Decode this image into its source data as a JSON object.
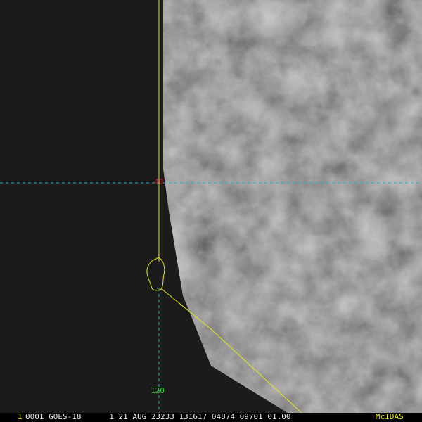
{
  "app": {
    "name": "McIDAS"
  },
  "colors": {
    "background": "#1c1c1c",
    "latlon_grid": "#1fb5c6",
    "map_overlay": "#e6e61a",
    "latitude_label": "#c0181e",
    "longitude_label": "#2ecc2e",
    "status_text": "#e8e8e8",
    "frame_number": "#e6e61a",
    "app_tag": "#e6e61a"
  },
  "grid": {
    "latitude_label": "40",
    "longitude_label": "120"
  },
  "status": {
    "frame_number": "1",
    "frame_text": "0001 GOES-18      1 21 AUG 23233 131617 04874 09701 01.00",
    "app_tag": "McIDAS"
  }
}
